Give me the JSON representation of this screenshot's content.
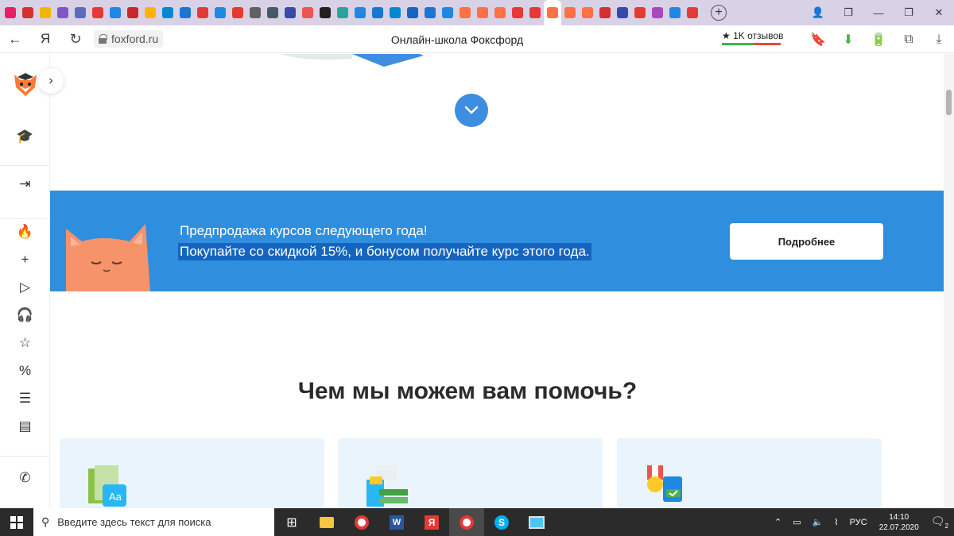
{
  "browser": {
    "url": "foxford.ru",
    "page_title": "Онлайн-школа Фоксфорд",
    "reviews_label": "★ 1K отзывов",
    "new_tab_label": "+",
    "tabs": [
      {
        "color": "#e91e63"
      },
      {
        "color": "#d32f2f"
      },
      {
        "color": "#f4b400"
      },
      {
        "color": "#7e57c2"
      },
      {
        "color": "#5c6bc0"
      },
      {
        "color": "#e53935"
      },
      {
        "color": "#1e88e5"
      },
      {
        "color": "#c62828"
      },
      {
        "color": "#ffb300"
      },
      {
        "color": "#0288d1"
      },
      {
        "color": "#1976d2"
      },
      {
        "color": "#e53935"
      },
      {
        "color": "#1e88e5"
      },
      {
        "color": "#e53935"
      },
      {
        "color": "#616161"
      },
      {
        "color": "#455a64"
      },
      {
        "color": "#3949ab"
      },
      {
        "color": "#ef5350"
      },
      {
        "color": "#212121"
      },
      {
        "color": "#26a69a"
      },
      {
        "color": "#1e88e5"
      },
      {
        "color": "#1976d2"
      },
      {
        "color": "#0288d1"
      },
      {
        "color": "#1565c0"
      },
      {
        "color": "#1976d2"
      },
      {
        "color": "#1e88e5"
      },
      {
        "color": "#ff7043"
      },
      {
        "color": "#ff7043"
      },
      {
        "color": "#ff7043"
      },
      {
        "color": "#e53935"
      },
      {
        "color": "#e53935"
      },
      {
        "color": "#ff7043",
        "active": true
      },
      {
        "color": "#ff7043"
      },
      {
        "color": "#ff7043"
      },
      {
        "color": "#d32f2f"
      },
      {
        "color": "#3949ab"
      },
      {
        "color": "#e53935"
      },
      {
        "color": "#ab47bc"
      },
      {
        "color": "#1e88e5"
      },
      {
        "color": "#e53935"
      }
    ]
  },
  "sidebar": {
    "items": [
      {
        "name": "courses-icon",
        "glyph": "🎓",
        "color": "#ff6a2b"
      },
      {
        "name": "login-icon",
        "glyph": "⇥",
        "color": "#333"
      },
      {
        "name": "fire-icon",
        "glyph": "🔥",
        "color": "#ff4d1a"
      },
      {
        "name": "plus-icon",
        "glyph": "+",
        "color": "#333"
      },
      {
        "name": "play-icon",
        "glyph": "▷",
        "color": "#333"
      },
      {
        "name": "headphones-icon",
        "glyph": "🎧",
        "color": "#333"
      },
      {
        "name": "star-icon",
        "glyph": "☆",
        "color": "#333"
      },
      {
        "name": "percent-icon",
        "glyph": "%",
        "color": "#333"
      },
      {
        "name": "list-icon",
        "glyph": "☰",
        "color": "#333"
      },
      {
        "name": "layout-icon",
        "glyph": "▤",
        "color": "#333"
      },
      {
        "name": "phone-icon",
        "glyph": "✆",
        "color": "#333"
      }
    ]
  },
  "banner": {
    "line1": "Предпродажа курсов следующего года!",
    "line2": "Покупайте со скидкой 15%, и бонусом получайте курс этого года.",
    "button": "Подробнее",
    "bg": "#2f8fde"
  },
  "section": {
    "heading": "Чем мы можем вам помочь?"
  },
  "taskbar": {
    "search_placeholder": "Введите здесь текст для поиска",
    "lang": "РУС",
    "time": "14:10",
    "date": "22.07.2020",
    "notifications": "2"
  }
}
